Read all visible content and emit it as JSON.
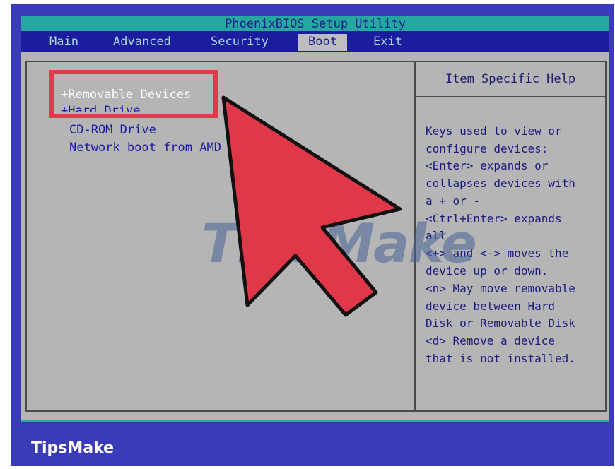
{
  "window": {
    "title": "PhoenixBIOS Setup Utility"
  },
  "menu": {
    "tabs": [
      {
        "label": "Main"
      },
      {
        "label": "Advanced"
      },
      {
        "label": "Security"
      },
      {
        "label": "Boot"
      },
      {
        "label": "Exit"
      }
    ],
    "active_tab": "Boot"
  },
  "boot_menu": {
    "items": [
      {
        "label": "+Removable Devices"
      },
      {
        "label": "+Hard Drive"
      },
      {
        "label": "CD-ROM Drive"
      },
      {
        "label": "Network boot from AMD"
      }
    ],
    "selected": "+Removable Devices"
  },
  "help": {
    "title": "Item Specific Help",
    "lines": [
      "Keys used to view or",
      "configure devices:",
      "<Enter> expands or",
      "collapses devices with",
      "a + or -",
      "<Ctrl+Enter> expands",
      "all",
      "<+> and <-> moves the",
      "device up or down.",
      "<n> May move removable",
      "device between Hard",
      "Disk or Removable Disk",
      "<d> Remove a device",
      "that is not installed."
    ]
  },
  "watermark": {
    "text": "TipsMake"
  },
  "footer": {
    "brand": "TipsMake"
  },
  "colors": {
    "frame_blue": "#3a3bb8",
    "title_teal": "#24a8a0",
    "menu_blue": "#1c1c9e",
    "screen_gray": "#b5b5b5",
    "annotation_red": "#e03a4c",
    "arrow_red": "#e03848"
  },
  "annotation": {
    "type": "arrow-pointer",
    "target": "+Removable Devices"
  }
}
